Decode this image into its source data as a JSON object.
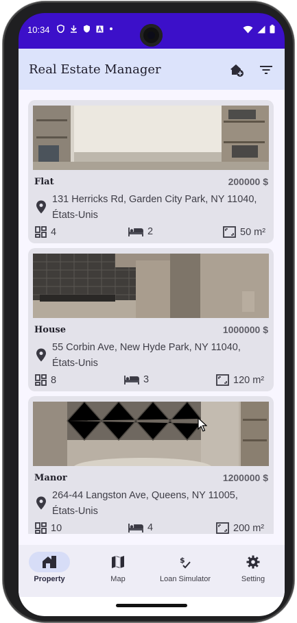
{
  "status_bar": {
    "time": "10:34"
  },
  "app_bar": {
    "title": "Real Estate Manager",
    "add_icon": "add-home-icon",
    "filter_icon": "filter-icon"
  },
  "properties": [
    {
      "type": "Flat",
      "price": "200000 $",
      "address": "131 Herricks Rd, Garden City Park, NY 11040, États-Unis",
      "rooms": "4",
      "bedrooms": "2",
      "surface": "50 m²"
    },
    {
      "type": "House",
      "price": "1000000 $",
      "address": "55 Corbin Ave, New Hyde Park, NY 11040, États-Unis",
      "rooms": "8",
      "bedrooms": "3",
      "surface": "120 m²"
    },
    {
      "type": "Manor",
      "price": "1200000 $",
      "address": "264-44 Langston Ave, Queens, NY 11005, États-Unis",
      "rooms": "10",
      "bedrooms": "4",
      "surface": "200 m²"
    }
  ],
  "nav": {
    "items": [
      {
        "label": "Property",
        "icon": "house-icon",
        "active": true
      },
      {
        "label": "Map",
        "icon": "map-icon",
        "active": false
      },
      {
        "label": "Loan Simulator",
        "icon": "loan-icon",
        "active": false
      },
      {
        "label": "Setting",
        "icon": "gear-icon",
        "active": false
      }
    ]
  },
  "colors": {
    "status_bar": "#3c10c9",
    "top_bar": "#dce3fb",
    "card": "#e3e2ea",
    "nav_bar": "#eeedf6",
    "active_pill": "#d7ddf7"
  }
}
